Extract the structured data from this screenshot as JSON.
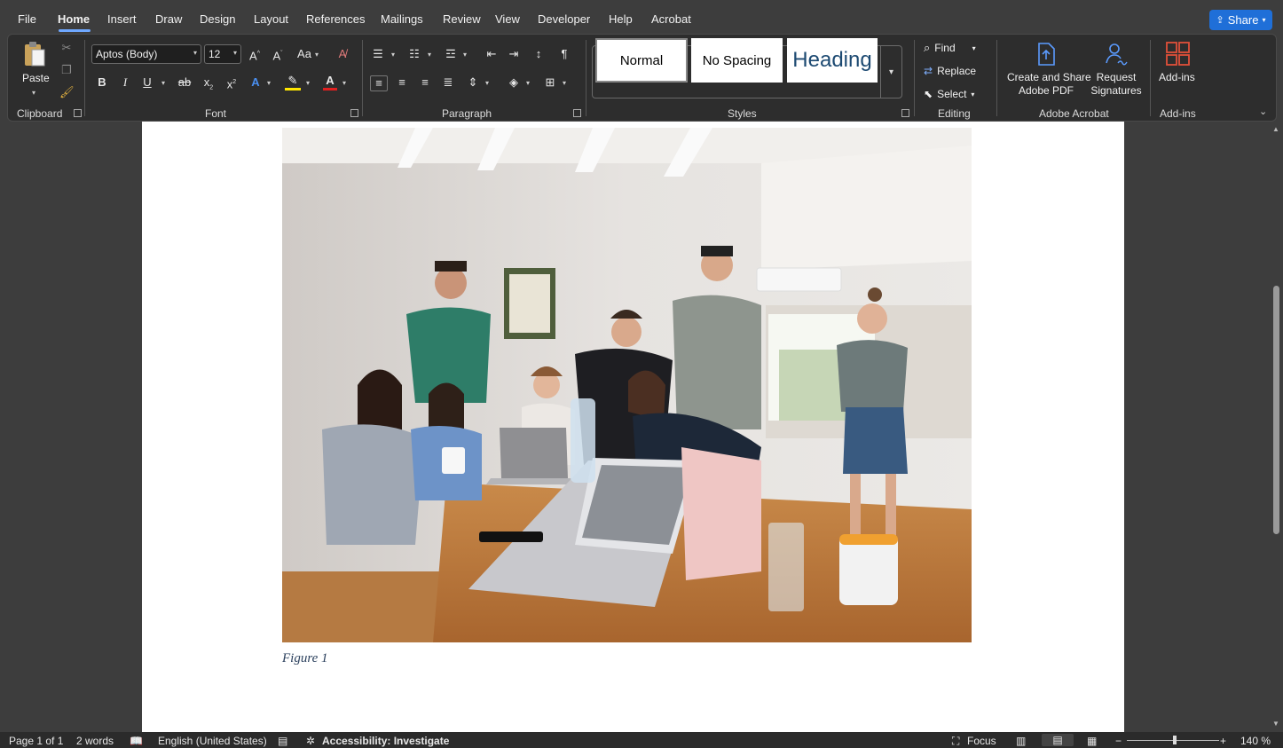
{
  "menu": {
    "items": [
      "File",
      "Home",
      "Insert",
      "Draw",
      "Design",
      "Layout",
      "References",
      "Mailings",
      "Review",
      "View",
      "Developer",
      "Help",
      "Acrobat"
    ],
    "active": "Home",
    "share_label": "Share"
  },
  "ribbon": {
    "clipboard": {
      "paste_label": "Paste",
      "group_label": "Clipboard"
    },
    "font": {
      "font_name": "Aptos (Body)",
      "font_size": "12",
      "group_label": "Font"
    },
    "paragraph": {
      "group_label": "Paragraph"
    },
    "styles": {
      "tiles": [
        "Normal",
        "No Spacing",
        "Heading"
      ],
      "group_label": "Styles"
    },
    "editing": {
      "find_label": "Find",
      "replace_label": "Replace",
      "select_label": "Select",
      "group_label": "Editing"
    },
    "acrobat": {
      "create_label_1": "Create and Share",
      "create_label_2": "Adobe PDF",
      "request_label_1": "Request",
      "request_label_2": "Signatures",
      "group_label": "Adobe Acrobat"
    },
    "addins": {
      "button_label": "Add-ins",
      "group_label": "Add-ins"
    }
  },
  "document": {
    "caption": "Figure 1"
  },
  "status": {
    "page": "Page 1 of 1",
    "words": "2 words",
    "language": "English (United States)",
    "accessibility": "Accessibility: Investigate",
    "focus": "Focus",
    "zoom": "140 %"
  },
  "colors": {
    "accent": "#1f6fd8",
    "page": "#ffffff",
    "app_bg": "#3d3d3d"
  }
}
